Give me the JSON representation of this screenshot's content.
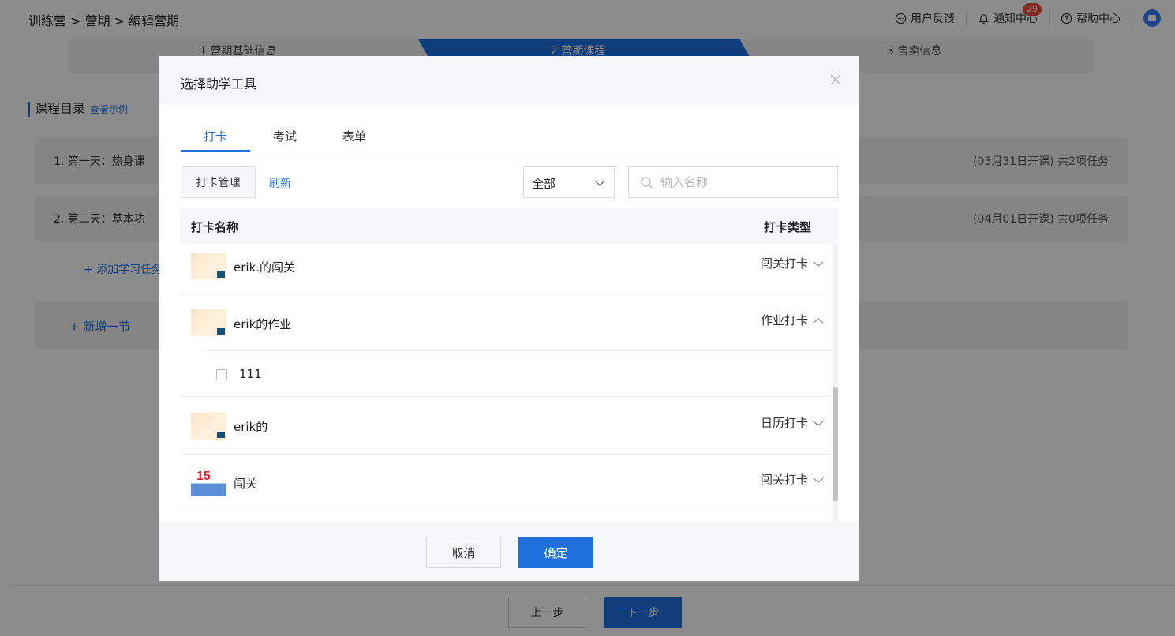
{
  "header": {
    "breadcrumb": "训练营 > 营期 > 编辑营期",
    "feedback": "用户反馈",
    "notifications": "通知中心",
    "notification_count": "29",
    "help": "帮助中心"
  },
  "steps": [
    "1 营期基础信息",
    "2 营期课程",
    "3 售卖信息"
  ],
  "catalog": {
    "title": "课程目录",
    "example_link": "查看示例",
    "days": [
      {
        "label": "1. 第一天：热身课",
        "meta": "(03月31日开课)  共2项任务"
      },
      {
        "label": "2. 第二天：基本功",
        "meta": "(04月01日开课)  共0项任务"
      }
    ],
    "add_task": "+ 添加学习任务",
    "new_section": "+ 新增一节"
  },
  "footer": {
    "prev": "上一步",
    "next": "下一步"
  },
  "modal": {
    "title": "选择助学工具",
    "tabs": [
      "打卡",
      "考试",
      "表单"
    ],
    "manage_button": "打卡管理",
    "refresh_link": "刷新",
    "filter_selected": "全部",
    "search_placeholder": "输入名称",
    "columns": {
      "name": "打卡名称",
      "type": "打卡类型"
    },
    "rows": [
      {
        "name": "erik.的闯关",
        "type": "闯关打卡",
        "expanded": false
      },
      {
        "name": "erik的作业",
        "type": "作业打卡",
        "expanded": true,
        "children": [
          {
            "label": "111",
            "checked": false
          }
        ]
      },
      {
        "name": "erik的",
        "type": "日历打卡",
        "expanded": false
      },
      {
        "name": "闯关",
        "type": "闯关打卡",
        "expanded": false,
        "thumb_text": "15"
      }
    ],
    "cancel": "取消",
    "confirm": "确定"
  },
  "colors": {
    "primary": "#1f6fde",
    "badge": "#e74c3c"
  }
}
